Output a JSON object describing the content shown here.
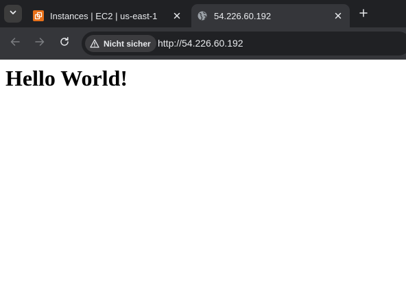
{
  "browser": {
    "tabs": [
      {
        "title": "Instances | EC2 | us-east-1",
        "favicon": "aws-ec2-icon",
        "active": false
      },
      {
        "title": "54.226.60.192",
        "favicon": "globe-icon",
        "active": true
      }
    ],
    "security_chip": "Nicht sicher",
    "url": "http://54.226.60.192"
  },
  "page": {
    "heading": "Hello World!"
  },
  "colors": {
    "tabstrip": "#202124",
    "toolbar": "#35363a",
    "omnibox": "#202124",
    "aws_orange": "#e8711a"
  }
}
